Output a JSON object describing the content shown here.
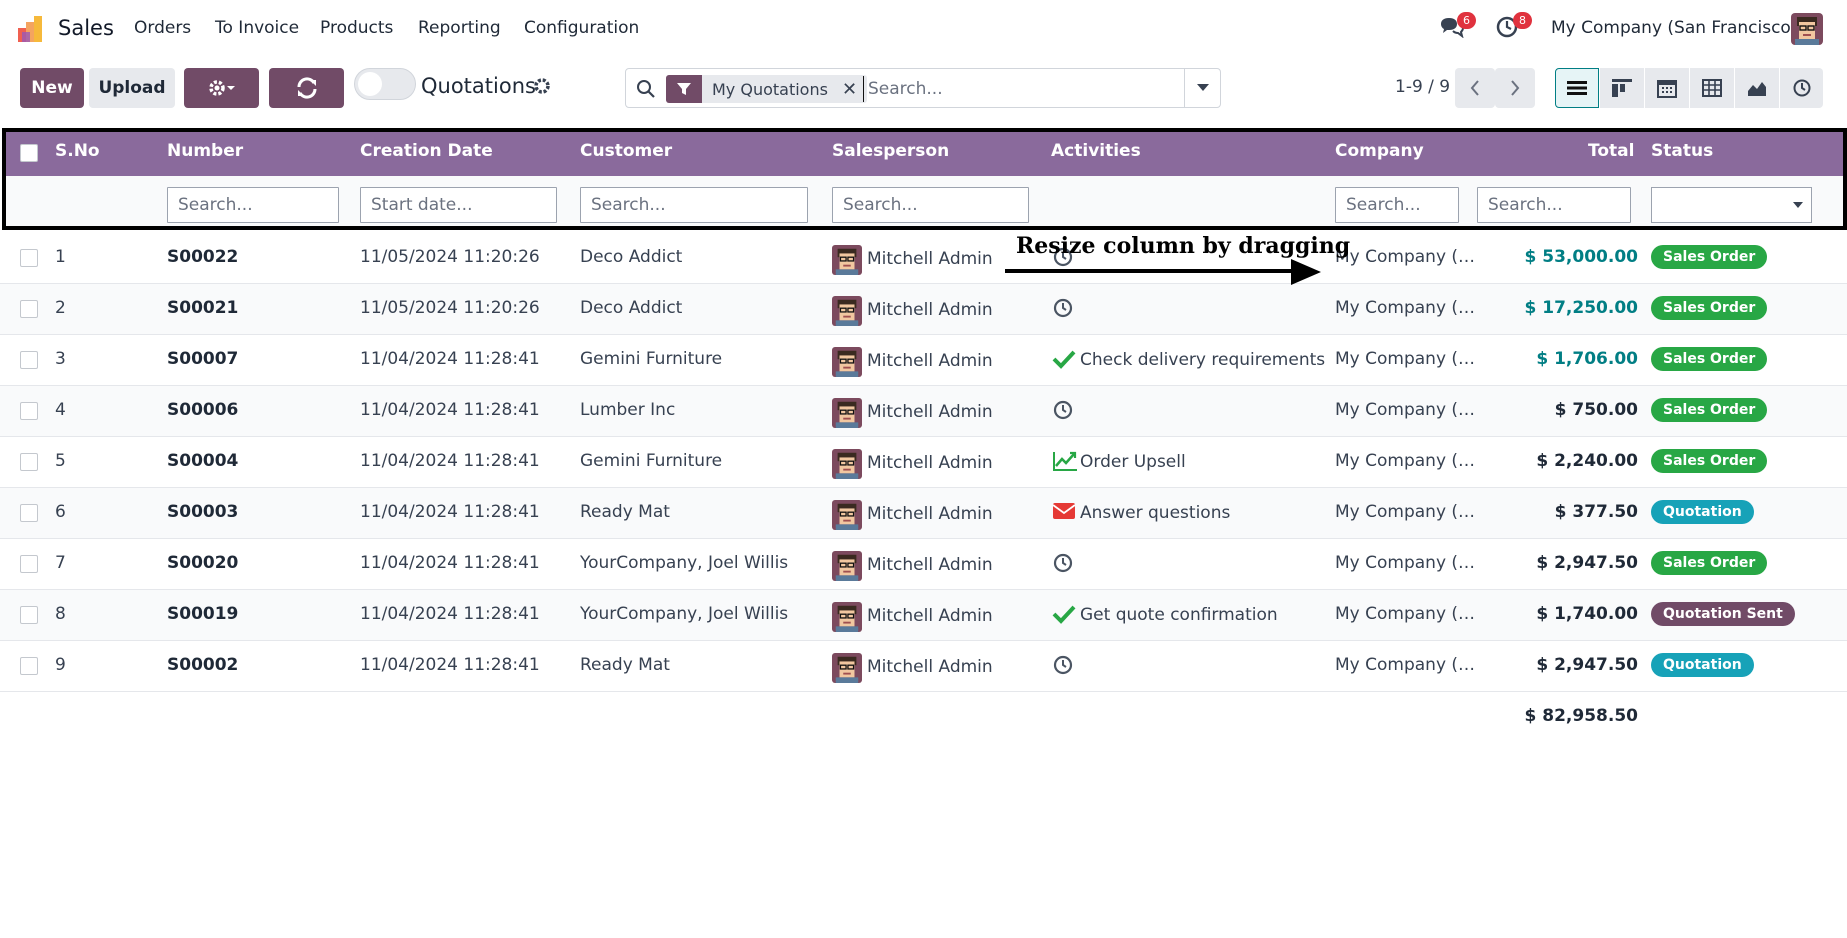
{
  "app": {
    "name": "Sales"
  },
  "menu": [
    "Orders",
    "To Invoice",
    "Products",
    "Reporting",
    "Configuration"
  ],
  "topbar": {
    "messages_count": "6",
    "activities_count": "8",
    "company": "My Company (San Francisco)"
  },
  "control": {
    "new_label": "New",
    "upload_label": "Upload",
    "view_title": "Quotations",
    "facet_label": "My Quotations",
    "search_placeholder": "Search...",
    "pager": "1-9 / 9"
  },
  "columns": {
    "sno": "S.No",
    "number": "Number",
    "creation_date": "Creation Date",
    "customer": "Customer",
    "salesperson": "Salesperson",
    "activities": "Activities",
    "company": "Company",
    "total": "Total",
    "status": "Status"
  },
  "filters": {
    "number": "Search...",
    "creation_date": "Start date...",
    "customer": "Search...",
    "salesperson": "Search...",
    "company": "Search...",
    "total": "Search..."
  },
  "rows": [
    {
      "sno": "1",
      "number": "S00022",
      "date": "11/05/2024 11:20:26",
      "customer": "Deco Addict",
      "salesperson": "Mitchell Admin",
      "activity_icon": "clock-icon",
      "activity": "",
      "company": "My Company (…",
      "total": "$ 53,000.00",
      "total_highlight": true,
      "status": "Sales Order"
    },
    {
      "sno": "2",
      "number": "S00021",
      "date": "11/05/2024 11:20:26",
      "customer": "Deco Addict",
      "salesperson": "Mitchell Admin",
      "activity_icon": "clock-icon",
      "activity": "",
      "company": "My Company (…",
      "total": "$ 17,250.00",
      "total_highlight": true,
      "status": "Sales Order"
    },
    {
      "sno": "3",
      "number": "S00007",
      "date": "11/04/2024 11:28:41",
      "customer": "Gemini Furniture",
      "salesperson": "Mitchell Admin",
      "activity_icon": "check-icon",
      "activity": "Check delivery requirements",
      "company": "My Company (…",
      "total": "$ 1,706.00",
      "total_highlight": true,
      "status": "Sales Order"
    },
    {
      "sno": "4",
      "number": "S00006",
      "date": "11/04/2024 11:28:41",
      "customer": "Lumber Inc",
      "salesperson": "Mitchell Admin",
      "activity_icon": "clock-icon",
      "activity": "",
      "company": "My Company (…",
      "total": "$ 750.00",
      "total_highlight": false,
      "status": "Sales Order"
    },
    {
      "sno": "5",
      "number": "S00004",
      "date": "11/04/2024 11:28:41",
      "customer": "Gemini Furniture",
      "salesperson": "Mitchell Admin",
      "activity_icon": "chart-up-icon",
      "activity": "Order Upsell",
      "company": "My Company (…",
      "total": "$ 2,240.00",
      "total_highlight": false,
      "status": "Sales Order"
    },
    {
      "sno": "6",
      "number": "S00003",
      "date": "11/04/2024 11:28:41",
      "customer": "Ready Mat",
      "salesperson": "Mitchell Admin",
      "activity_icon": "envelope-icon",
      "activity": "Answer questions",
      "company": "My Company (…",
      "total": "$ 377.50",
      "total_highlight": false,
      "status": "Quotation"
    },
    {
      "sno": "7",
      "number": "S00020",
      "date": "11/04/2024 11:28:41",
      "customer": "YourCompany, Joel Willis",
      "salesperson": "Mitchell Admin",
      "activity_icon": "clock-icon",
      "activity": "",
      "company": "My Company (…",
      "total": "$ 2,947.50",
      "total_highlight": false,
      "status": "Sales Order"
    },
    {
      "sno": "8",
      "number": "S00019",
      "date": "11/04/2024 11:28:41",
      "customer": "YourCompany, Joel Willis",
      "salesperson": "Mitchell Admin",
      "activity_icon": "check-icon",
      "activity": "Get quote confirmation",
      "company": "My Company (…",
      "total": "$ 1,740.00",
      "total_highlight": false,
      "status": "Quotation Sent"
    },
    {
      "sno": "9",
      "number": "S00002",
      "date": "11/04/2024 11:28:41",
      "customer": "Ready Mat",
      "salesperson": "Mitchell Admin",
      "activity_icon": "clock-icon",
      "activity": "",
      "company": "My Company (…",
      "total": "$ 2,947.50",
      "total_highlight": false,
      "status": "Quotation"
    }
  ],
  "grand_total": "$ 82,958.50",
  "status_colors": {
    "Sales Order": "#28a745",
    "Quotation": "#17a2b8",
    "Quotation Sent": "#714b67"
  },
  "colors": {
    "brand": "#714b67",
    "header": "#8a6a9c",
    "link": "#017e84"
  },
  "annotation": {
    "text": "Resize column by dragging"
  }
}
